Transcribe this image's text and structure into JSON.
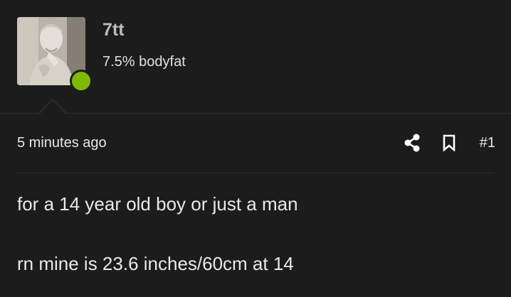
{
  "user": {
    "name": "7tt",
    "title": "7.5% bodyfat",
    "status_color": "#7fba00"
  },
  "post": {
    "timestamp": "5 minutes ago",
    "number": "#1",
    "lines": [
      "for a 14 year old boy or just a man",
      "rn mine is 23.6 inches/60cm at 14"
    ]
  },
  "icons": {
    "share": "share-icon",
    "bookmark": "bookmark-icon"
  },
  "colors": {
    "background": "#1c1c1c",
    "text": "#e6e6e6",
    "username": "#bdbdbd"
  }
}
